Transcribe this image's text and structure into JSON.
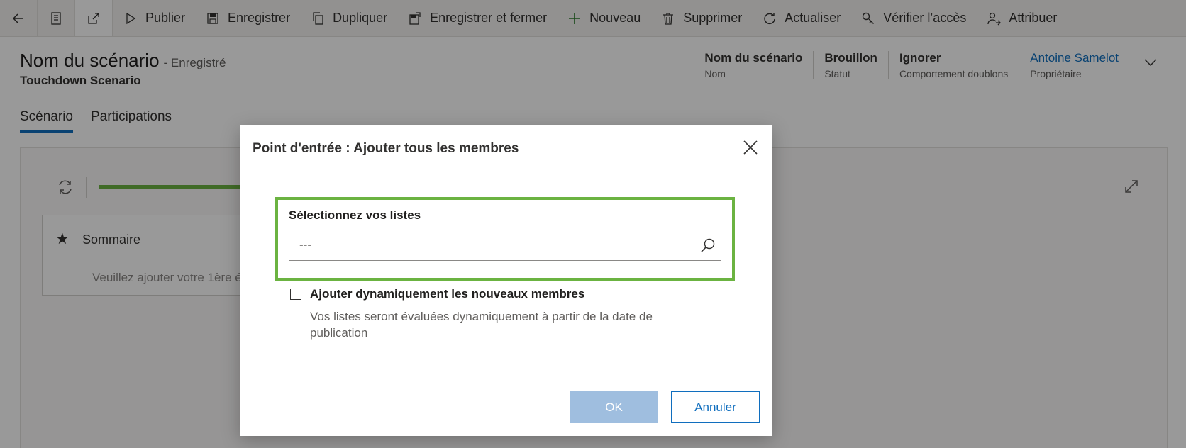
{
  "commandbar": {
    "items": [
      {
        "label": "Publier",
        "icon": "play-icon"
      },
      {
        "label": "Enregistrer",
        "icon": "save-icon"
      },
      {
        "label": "Dupliquer",
        "icon": "copy-icon"
      },
      {
        "label": "Enregistrer et fermer",
        "icon": "save-close-icon"
      },
      {
        "label": "Nouveau",
        "icon": "plus-icon"
      },
      {
        "label": "Supprimer",
        "icon": "trash-icon"
      },
      {
        "label": "Actualiser",
        "icon": "refresh-icon"
      },
      {
        "label": "Vérifier l’accès",
        "icon": "key-search-icon"
      },
      {
        "label": "Attribuer",
        "icon": "person-assign-icon"
      }
    ]
  },
  "record": {
    "title": "Nom du scénario",
    "state": "- Enregistré",
    "subtitle": "Touchdown Scenario"
  },
  "header_fields": [
    {
      "value": "Nom du scénario",
      "label": "Nom"
    },
    {
      "value": "Brouillon",
      "label": "Statut"
    },
    {
      "value": "Ignorer",
      "label": "Comportement doublons"
    },
    {
      "value": "Antoine Samelot",
      "label": "Propriétaire"
    }
  ],
  "tabs": [
    {
      "label": "Scénario",
      "selected": true
    },
    {
      "label": "Participations",
      "selected": false
    }
  ],
  "canvas": {
    "summary_label": "Sommaire",
    "summary_hint": "Veuillez ajouter votre 1ère é"
  },
  "dialog": {
    "title": "Point d'entrée : Ajouter tous les membres",
    "select_label": "Sélectionnez vos listes",
    "select_placeholder": "---",
    "checkbox_label": "Ajouter dynamiquement les nouveaux membres",
    "checkbox_checked": false,
    "checkbox_description": "Vos listes seront évaluées dynamiquement à partir de la date de publication",
    "ok_label": "OK",
    "cancel_label": "Annuler"
  },
  "colors": {
    "accent": "#106ebe",
    "highlight": "#6bb341",
    "ok_disabled": "#9fbedf"
  }
}
